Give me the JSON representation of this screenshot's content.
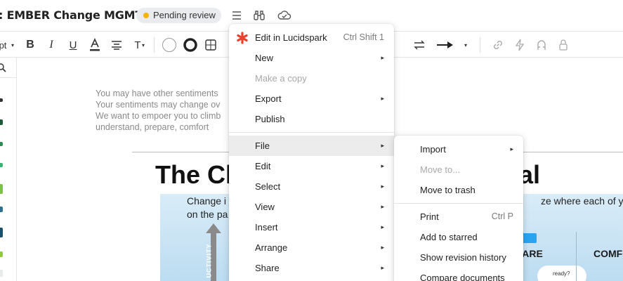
{
  "header": {
    "title": ": EMBER Change MGMT",
    "status": "Pending review"
  },
  "toolbar": {
    "font_size_fragment": "pt"
  },
  "canvas": {
    "sentiments": [
      "You may have other sentiments",
      "Your sentiments may change ov",
      "We want to empoer you to climb",
      "understand, prepare, comfort"
    ],
    "heading_left": "The Cl",
    "heading_right": "al",
    "slide_text_1": "Change i",
    "slide_text_2": "on the pa",
    "slide_text_3": "ze where each of you",
    "slide_arrow_text": "UCTIVITY",
    "slide_pare": "PARE",
    "slide_comfo": "COMFO",
    "slide_ready": "ready?"
  },
  "main_menu": {
    "items": [
      {
        "label": "Edit in Lucidspark",
        "shortcut": "Ctrl Shift 1",
        "icon": "lucidspark-icon"
      },
      {
        "label": "New",
        "submenu": true
      },
      {
        "label": "Make a copy",
        "disabled": true
      },
      {
        "label": "Export",
        "submenu": true
      },
      {
        "label": "Publish"
      },
      {
        "label": "File",
        "submenu": true,
        "active": true
      },
      {
        "label": "Edit",
        "submenu": true
      },
      {
        "label": "Select",
        "submenu": true
      },
      {
        "label": "View",
        "submenu": true
      },
      {
        "label": "Insert",
        "submenu": true
      },
      {
        "label": "Arrange",
        "submenu": true
      },
      {
        "label": "Share",
        "submenu": true
      }
    ]
  },
  "file_submenu": {
    "items": [
      {
        "label": "Import",
        "submenu": true
      },
      {
        "label": "Move to...",
        "disabled": true
      },
      {
        "label": "Move to trash"
      },
      {
        "label": "Print",
        "shortcut": "Ctrl P"
      },
      {
        "label": "Add to starred"
      },
      {
        "label": "Show revision history"
      },
      {
        "label": "Compare documents"
      }
    ]
  },
  "colors": {
    "status_dot": "#f5b400",
    "lucidspark_red": "#e8412c",
    "active_item_bg": "#ececec"
  }
}
